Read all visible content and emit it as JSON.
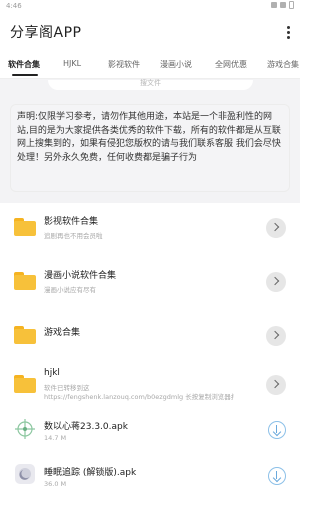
{
  "status_bar": {
    "time": "4:46"
  },
  "app": {
    "title": "分享阁APP"
  },
  "tabs": [
    {
      "label": "软件合集",
      "active": true
    },
    {
      "label": "HJKL",
      "active": false
    },
    {
      "label": "影视软件",
      "active": false
    },
    {
      "label": "漫画小说",
      "active": false
    },
    {
      "label": "全网优惠",
      "active": false
    },
    {
      "label": "游戏合集",
      "active": false
    }
  ],
  "search_remnant": {
    "text": "搜文件"
  },
  "notice": {
    "text": "声明:仅限学习参考，请勿作其他用途，本站是一个非盈利性的网站,目的是为大家提供各类优秀的软件下载，所有的软件都是从互联网上搜集到的，如果有侵犯您版权的请与我们联系客服 我们会尽快处理！另外永久免费，任何收费都是骗子行为"
  },
  "items": [
    {
      "type": "folder",
      "name": "影视软件合集",
      "sub": "追剧再也不用会员啦"
    },
    {
      "type": "folder",
      "name": "漫画小说软件合集",
      "sub": "漫画小说应有尽有"
    },
    {
      "type": "folder",
      "name": "游戏合集",
      "sub": ""
    },
    {
      "type": "folder",
      "name": "hjkl",
      "sub": "软件已转移到这",
      "sub2": "https://fengshenk.lanzouq.com/b0ezgdmlg 长按复制浏览器打..."
    },
    {
      "type": "file",
      "name": "数以心蒋23.3.0.apk",
      "size": "14.7 M",
      "icon": "crosshair-app-icon"
    },
    {
      "type": "file",
      "name": "睡眠追踪 (解锁版).apk",
      "size": "36.0 M",
      "icon": "sleep-app-icon"
    }
  ]
}
